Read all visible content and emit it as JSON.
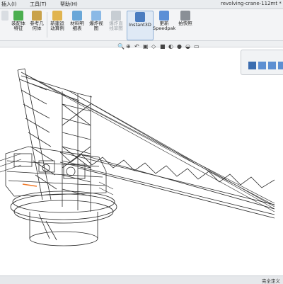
{
  "menubar": {
    "items": [
      "插入(I)",
      "工具(T)",
      "帮助(H)"
    ],
    "doc_title": "revolving-crane-112mt *"
  },
  "ribbon": {
    "buttons": [
      {
        "label": "装配体\n特征"
      },
      {
        "label": "参考几\n何体"
      },
      {
        "label": "新建运\n动算例"
      },
      {
        "label": "材料明\n细表"
      },
      {
        "label": "爆炸视\n图"
      },
      {
        "label": "爆炸直\n线草图"
      },
      {
        "label": "Instant3D"
      },
      {
        "label": "更新\nSpeedpak"
      },
      {
        "label": "拍快照"
      }
    ]
  },
  "statusbar": {
    "text": "完全定义"
  },
  "colors": {
    "accent": "#4a7cc0",
    "model_stroke": "#2b2b2b",
    "highlight": "#f07a2a"
  }
}
